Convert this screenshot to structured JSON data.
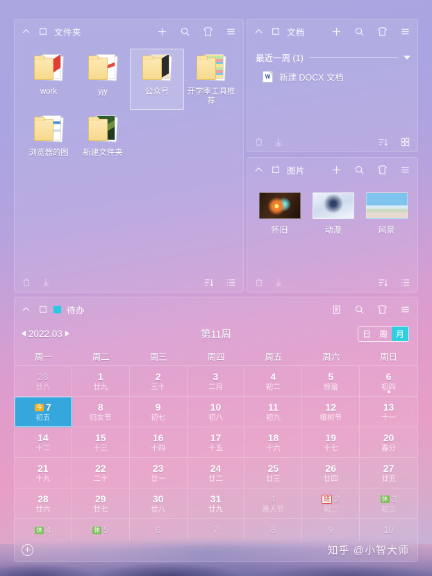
{
  "panels": {
    "folders": {
      "title": "文件夹",
      "header_icons": [
        "collapse-icon",
        "pin-icon",
        "add-icon",
        "search-icon",
        "skin-icon",
        "menu-icon"
      ],
      "footer_icons": [
        "trash-icon",
        "download-icon",
        "sort-icon",
        "list-view-icon"
      ],
      "items": [
        {
          "label": "work",
          "selected": false
        },
        {
          "label": "yjy",
          "selected": false
        },
        {
          "label": "公众号",
          "selected": true
        },
        {
          "label": "开学季工具推荐",
          "selected": false
        },
        {
          "label": "浏览器的图",
          "selected": false
        },
        {
          "label": "新建文件夹",
          "selected": false
        }
      ]
    },
    "docs": {
      "title": "文档",
      "group_label": "最近一周 (1)",
      "items": [
        {
          "label": "新建 DOCX 文档",
          "type": "docx",
          "badge": "W"
        }
      ],
      "footer_icons": [
        "trash-icon",
        "download-icon",
        "sort-icon",
        "grid-view-icon"
      ]
    },
    "pics": {
      "title": "图片",
      "items": [
        {
          "label": "怀旧"
        },
        {
          "label": "动漫"
        },
        {
          "label": "风景"
        }
      ],
      "footer_icons": [
        "trash-icon",
        "download-icon",
        "sort-icon",
        "list-view-icon"
      ]
    },
    "todo": {
      "title": "待办",
      "accent_color": "#25cbe0",
      "header_icons": [
        "collapse-icon",
        "pin-icon",
        "note-icon",
        "search-icon",
        "skin-icon",
        "menu-icon"
      ],
      "year_month": "2022.03",
      "week_label": "第11周",
      "view_modes": [
        {
          "label": "日",
          "active": false
        },
        {
          "label": "周",
          "active": false
        },
        {
          "label": "月",
          "active": true
        }
      ],
      "weekdays": [
        "周一",
        "周二",
        "周三",
        "周四",
        "周五",
        "周六",
        "周日"
      ],
      "days": [
        {
          "num": "28",
          "lunar": "廿八",
          "out": true
        },
        {
          "num": "1",
          "lunar": "廿九",
          "out": false
        },
        {
          "num": "2",
          "lunar": "三十",
          "out": false
        },
        {
          "num": "3",
          "lunar": "二月",
          "out": false
        },
        {
          "num": "4",
          "lunar": "初二",
          "out": false
        },
        {
          "num": "5",
          "lunar": "惊蛰",
          "out": false
        },
        {
          "num": "6",
          "lunar": "初四",
          "out": false,
          "dot": true
        },
        {
          "num": "7",
          "lunar": "初五",
          "out": false,
          "today": true,
          "tag": "今",
          "tag_type": "today-tag"
        },
        {
          "num": "8",
          "lunar": "妇女节",
          "out": false
        },
        {
          "num": "9",
          "lunar": "初七",
          "out": false
        },
        {
          "num": "10",
          "lunar": "初八",
          "out": false
        },
        {
          "num": "11",
          "lunar": "初九",
          "out": false
        },
        {
          "num": "12",
          "lunar": "植树节",
          "out": false
        },
        {
          "num": "13",
          "lunar": "十一",
          "out": false
        },
        {
          "num": "14",
          "lunar": "十二",
          "out": false
        },
        {
          "num": "15",
          "lunar": "十三",
          "out": false
        },
        {
          "num": "16",
          "lunar": "十四",
          "out": false
        },
        {
          "num": "17",
          "lunar": "十五",
          "out": false
        },
        {
          "num": "18",
          "lunar": "十六",
          "out": false
        },
        {
          "num": "19",
          "lunar": "十七",
          "out": false
        },
        {
          "num": "20",
          "lunar": "春分",
          "out": false
        },
        {
          "num": "21",
          "lunar": "十九",
          "out": false
        },
        {
          "num": "22",
          "lunar": "二十",
          "out": false
        },
        {
          "num": "23",
          "lunar": "廿一",
          "out": false
        },
        {
          "num": "24",
          "lunar": "廿二",
          "out": false
        },
        {
          "num": "25",
          "lunar": "廿三",
          "out": false
        },
        {
          "num": "26",
          "lunar": "廿四",
          "out": false
        },
        {
          "num": "27",
          "lunar": "廿五",
          "out": false
        },
        {
          "num": "28",
          "lunar": "廿六",
          "out": false
        },
        {
          "num": "29",
          "lunar": "廿七",
          "out": false
        },
        {
          "num": "30",
          "lunar": "廿八",
          "out": false
        },
        {
          "num": "31",
          "lunar": "廿九",
          "out": false
        },
        {
          "num": "1",
          "lunar": "愚人节",
          "out": true
        },
        {
          "num": "2",
          "lunar": "初二",
          "out": true,
          "tag": "班",
          "tag_type": "ban"
        },
        {
          "num": "3",
          "lunar": "初三",
          "out": true,
          "tag": "休",
          "tag_type": "xiu"
        },
        {
          "num": "4",
          "lunar": "",
          "out": true,
          "tail": true,
          "tag": "休",
          "tag_type": "xiu"
        },
        {
          "num": "5",
          "lunar": "",
          "out": true,
          "tail": true,
          "tag": "休",
          "tag_type": "xiu"
        },
        {
          "num": "6",
          "lunar": "",
          "out": true,
          "tail": true
        },
        {
          "num": "7",
          "lunar": "",
          "out": true,
          "tail": true
        },
        {
          "num": "8",
          "lunar": "",
          "out": true,
          "tail": true
        },
        {
          "num": "9",
          "lunar": "",
          "out": true,
          "tail": true
        },
        {
          "num": "10",
          "lunar": "",
          "out": true,
          "tail": true
        }
      ],
      "add_label": "add-todo-icon",
      "watermark": "知乎 @小智大师"
    }
  }
}
